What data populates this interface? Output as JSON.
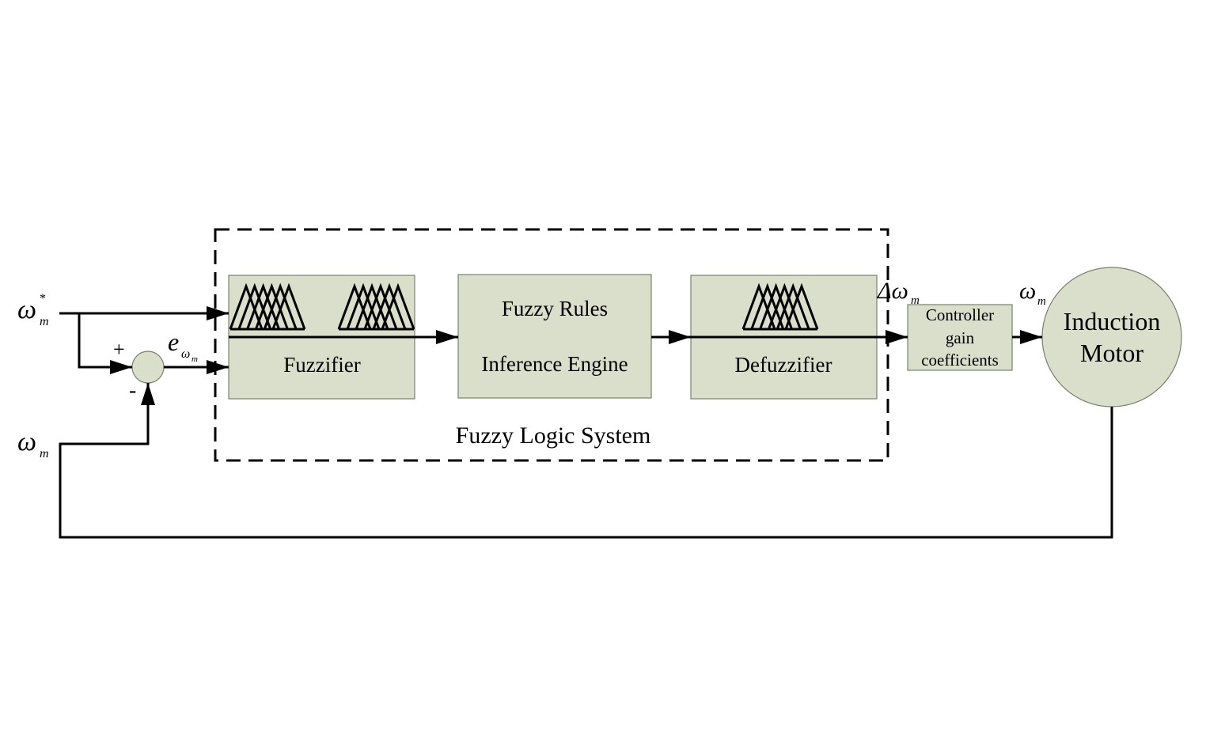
{
  "diagram": {
    "group_label": "Fuzzy Logic System",
    "blocks": {
      "fuzzifier": "Fuzzifier",
      "rules": "Fuzzy Rules",
      "inference": "Inference Engine",
      "defuzzifier": "Defuzzifier",
      "gain_line1": "Controller",
      "gain_line2": "gain",
      "gain_line3": "coefficients",
      "motor_line1": "Induction",
      "motor_line2": "Motor"
    },
    "signals": {
      "reference_main": "ω",
      "reference_sub": "m",
      "reference_sup": "*",
      "feedback_main": "ω",
      "feedback_sub": "m",
      "error_main": "e",
      "error_sub": "ω",
      "error_subsub": "m",
      "delta_main": "Δω",
      "delta_sub": "m",
      "output_main": "ω",
      "output_sub": "m"
    },
    "summing_junction": {
      "plus": "+",
      "minus": "-"
    },
    "colors": {
      "block_fill": "#dadfcc",
      "line": "#000000"
    }
  }
}
